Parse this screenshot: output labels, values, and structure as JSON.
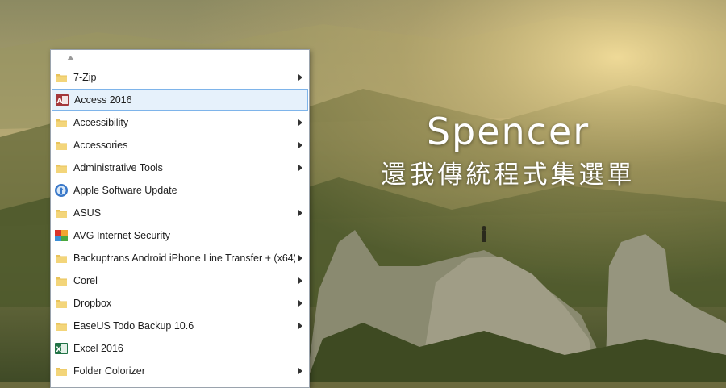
{
  "brand": {
    "title": "Spencer",
    "subtitle": "還我傳統程式集選單"
  },
  "menu": {
    "scroll_icon": "scroll-up-arrow-icon",
    "items": [
      {
        "label": "7-Zip",
        "icon": "folder-icon",
        "submenu": true
      },
      {
        "label": "Access 2016",
        "icon": "access-icon",
        "submenu": false,
        "selected": true
      },
      {
        "label": "Accessibility",
        "icon": "folder-icon",
        "submenu": true
      },
      {
        "label": "Accessories",
        "icon": "folder-icon",
        "submenu": true
      },
      {
        "label": "Administrative Tools",
        "icon": "folder-icon",
        "submenu": true
      },
      {
        "label": "Apple Software Update",
        "icon": "apple-update-icon",
        "submenu": false
      },
      {
        "label": "ASUS",
        "icon": "folder-icon",
        "submenu": true
      },
      {
        "label": "AVG Internet Security",
        "icon": "avg-icon",
        "submenu": false
      },
      {
        "label": "Backuptrans Android iPhone Line Transfer + (x64)",
        "icon": "folder-icon",
        "submenu": true
      },
      {
        "label": "Corel",
        "icon": "folder-icon",
        "submenu": true
      },
      {
        "label": "Dropbox",
        "icon": "folder-icon",
        "submenu": true
      },
      {
        "label": "EaseUS Todo Backup 10.6",
        "icon": "folder-icon",
        "submenu": true
      },
      {
        "label": "Excel 2016",
        "icon": "excel-icon",
        "submenu": false
      },
      {
        "label": "Folder Colorizer",
        "icon": "folder-icon",
        "submenu": true
      }
    ]
  },
  "colors": {
    "selection_bg": "#e6f1fb",
    "selection_border": "#7eb4ea",
    "folder": "#e9c35a",
    "access": "#a4373a",
    "excel": "#217346"
  }
}
